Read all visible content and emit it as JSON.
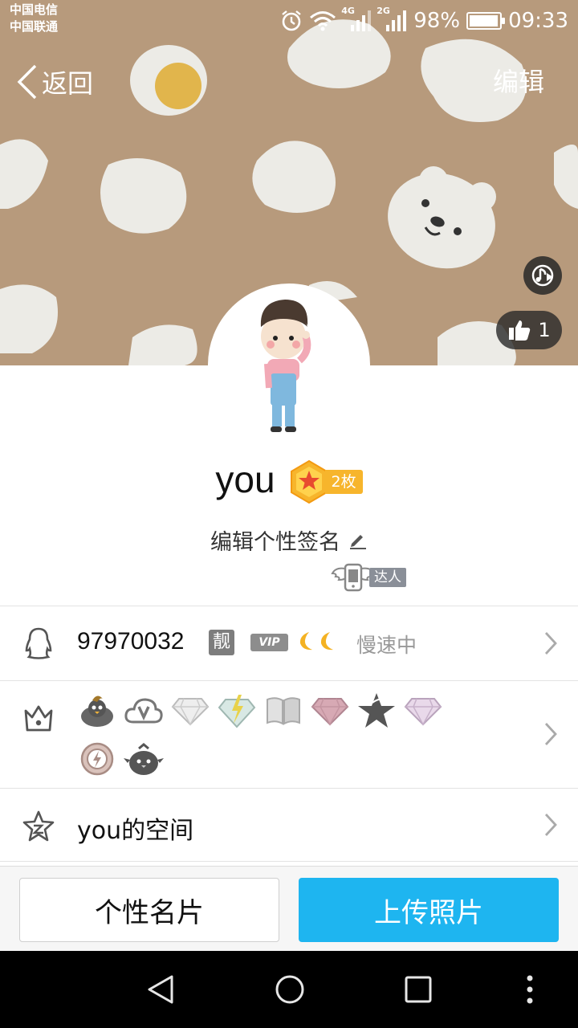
{
  "status_bar": {
    "carrier_1": "中国电信",
    "carrier_2": "中国联通",
    "net_1": "4G",
    "net_2": "2G",
    "battery": "98%",
    "battery_level": 0.98,
    "time": "09:33",
    "icons": [
      "alarm-icon",
      "wifi-icon",
      "signal-4g-icon",
      "signal-2g-icon",
      "battery-icon"
    ]
  },
  "header": {
    "back_label": "返回",
    "edit_label": "编辑",
    "like_count": "1",
    "icons": [
      "chevron-left-icon",
      "music-icon",
      "thumbs-up-icon"
    ]
  },
  "profile": {
    "nickname": "you",
    "medal_count": "2枚",
    "signature": "编辑个性签名",
    "talent_label": "达人"
  },
  "rows": {
    "qq_number": "97970032",
    "liang_label": "靓",
    "vip_label": "VIP",
    "speed_status": "慢速中",
    "space_label": "you的空间"
  },
  "actions": {
    "card_label": "个性名片",
    "upload_label": "上传照片"
  },
  "colors": {
    "cover_bg": "#b79a7c",
    "accent_blue": "#1eb5f0",
    "medal_gold": "#f7b52c"
  }
}
